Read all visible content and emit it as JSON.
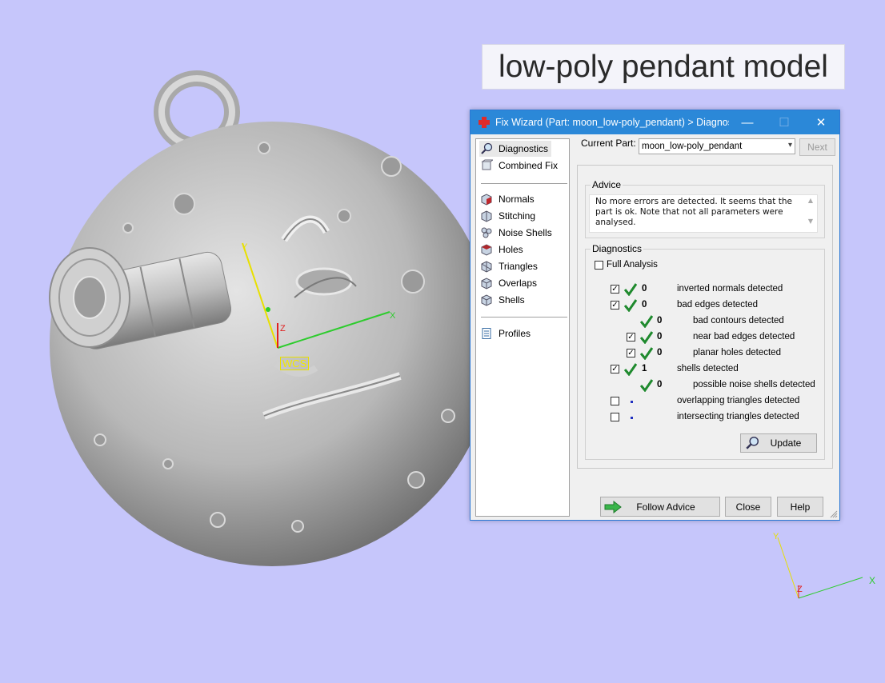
{
  "overlay": {
    "title": "low-poly pendant model",
    "wcs_label": "WCS"
  },
  "axes": {
    "x": "X",
    "y": "Y",
    "z": "Z"
  },
  "dialog": {
    "title": "Fix Wizard (Part: moon_low-poly_pendant) > Diagnos...",
    "controls": {
      "minimize": "—",
      "maximize": "☐",
      "close": "✕"
    },
    "sidebar": {
      "top_items": [
        {
          "label": "Diagnostics",
          "icon": "magnifier-icon",
          "selected": true
        },
        {
          "label": "Combined Fix",
          "icon": "combined-fix-icon"
        }
      ],
      "fix_items": [
        {
          "label": "Normals",
          "icon": "normals-cube-icon"
        },
        {
          "label": "Stitching",
          "icon": "stitching-cube-icon"
        },
        {
          "label": "Noise Shells",
          "icon": "noise-shells-icon"
        },
        {
          "label": "Holes",
          "icon": "holes-cube-icon"
        },
        {
          "label": "Triangles",
          "icon": "triangles-cube-icon"
        },
        {
          "label": "Overlaps",
          "icon": "overlaps-cube-icon"
        },
        {
          "label": "Shells",
          "icon": "shells-cube-icon"
        }
      ],
      "bottom_items": [
        {
          "label": "Profiles",
          "icon": "document-icon"
        }
      ]
    },
    "current_part_label": "Current Part:",
    "current_part_value": "moon_low-poly_pendant",
    "next_button": "Next",
    "advice": {
      "title": "Advice",
      "text": "No more errors are detected. It seems that the part is ok. Note that not all parameters were analysed."
    },
    "diagnostics": {
      "title": "Diagnostics",
      "full_analysis": {
        "label": "Full Analysis",
        "checked": false
      },
      "rows": [
        {
          "checked": true,
          "status": "ok",
          "count": "0",
          "label": "inverted normals detected"
        },
        {
          "checked": true,
          "status": "ok",
          "count": "0",
          "label": "bad edges detected"
        },
        {
          "checked": null,
          "status": "ok",
          "count": "0",
          "label": "bad contours detected"
        },
        {
          "checked": true,
          "status": "ok",
          "count": "0",
          "label": "near bad edges detected"
        },
        {
          "checked": true,
          "status": "ok",
          "count": "0",
          "label": "planar holes detected"
        },
        {
          "checked": true,
          "status": "ok",
          "count": "1",
          "label": "shells detected"
        },
        {
          "checked": null,
          "status": "ok",
          "count": "0",
          "label": "possible noise shells detected"
        },
        {
          "checked": false,
          "status": "pending",
          "count": "",
          "label": "overlapping triangles detected"
        },
        {
          "checked": false,
          "status": "pending",
          "count": "",
          "label": "intersecting triangles detected"
        }
      ],
      "update_button": "Update"
    },
    "footer": {
      "follow_advice": "Follow Advice",
      "close": "Close",
      "help": "Help"
    }
  },
  "colors": {
    "background": "#c6c6fb",
    "titlebar": "#2b88d8",
    "tick": "#1f8a2e",
    "axis_x": "#2ecc2e",
    "axis_y": "#e8e000",
    "axis_z": "#e02020"
  }
}
